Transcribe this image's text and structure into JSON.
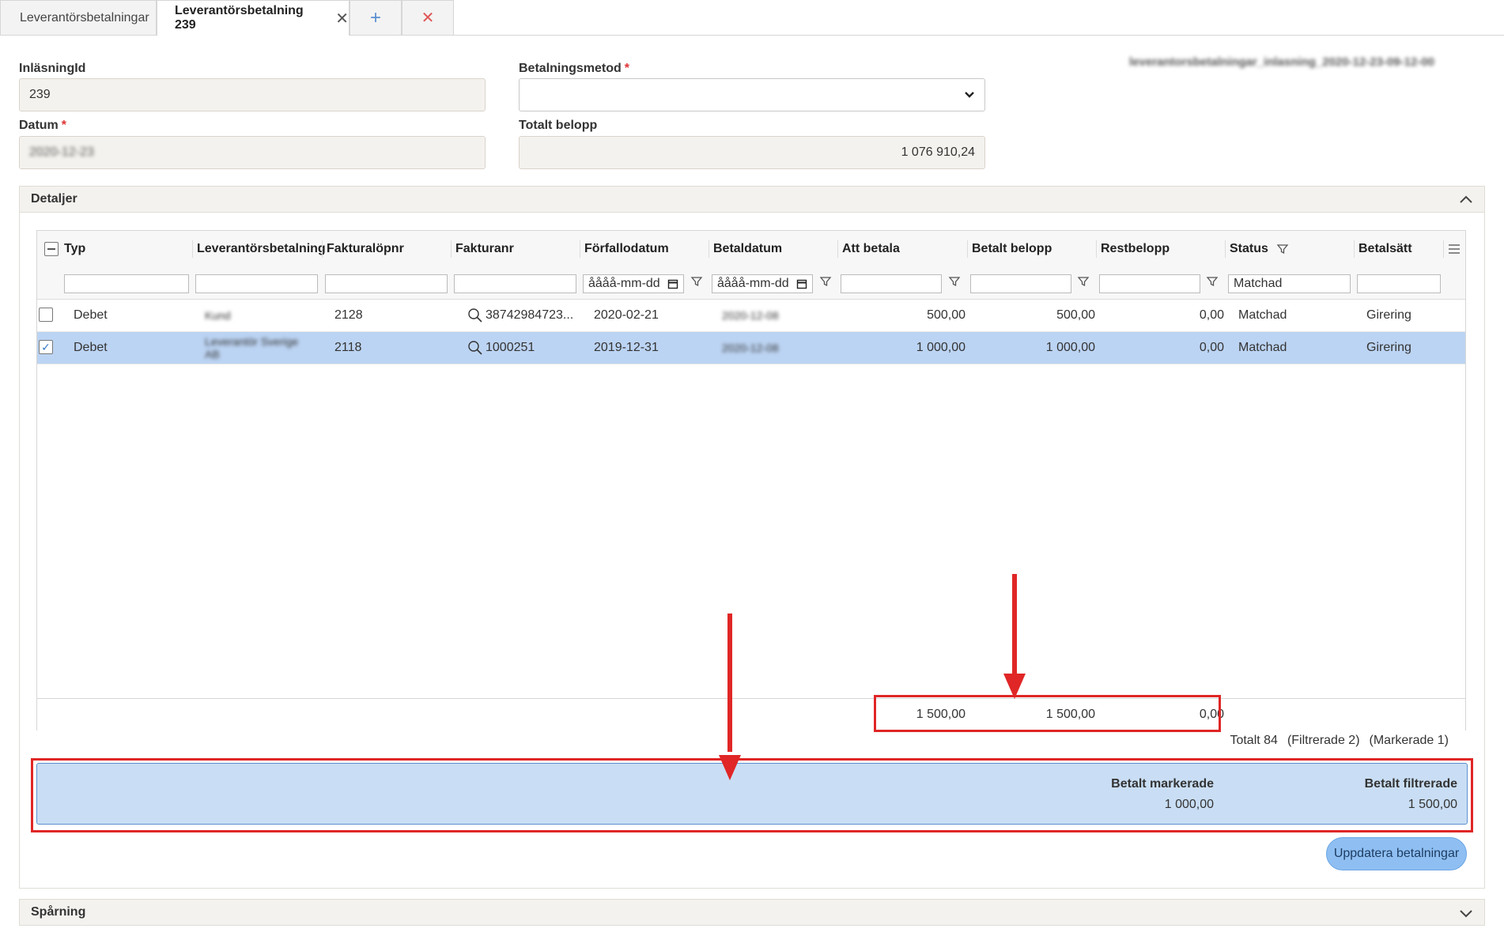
{
  "tabs": {
    "list_tab": "Leverantörsbetalningar",
    "active_tab": "Leverantörsbetalning 239",
    "close_icon": "✕",
    "add_icon": "+",
    "close_all_icon": "✕"
  },
  "form": {
    "id_label": "InläsningId",
    "id_value": "239",
    "date_label": "Datum",
    "date_required": "*",
    "date_value": "2020-12-23",
    "method_label": "Betalningsmetod",
    "method_required": "*",
    "method_value": "",
    "total_label": "Totalt belopp",
    "total_value": "1 076 910,24",
    "file_name": "leverantorsbetalningar_inlasning_2020-12-23-09-12-00"
  },
  "details": {
    "title": "Detaljer",
    "columns": [
      "Typ",
      "Leverantörsbetalning",
      "Fakturalöpnr",
      "Fakturanr",
      "Förfallodatum",
      "Betaldatum",
      "Att betala",
      "Betalt belopp",
      "Restbelopp",
      "Status",
      "Betalsätt"
    ],
    "filters": {
      "date_placeholder": "åååå-mm-dd",
      "status_value": "Matchad"
    },
    "rows": [
      {
        "typ": "Debet",
        "leverantor": "Kund",
        "lopnr": "2128",
        "fakturanr": "38742984723...",
        "forfallo": "2020-02-21",
        "betaldatum": "2020-12-08",
        "att_betala": "500,00",
        "betalt": "500,00",
        "rest": "0,00",
        "status": "Matchad",
        "betalsatt": "Girering",
        "selected": false
      },
      {
        "typ": "Debet",
        "leverantor": "Leverantör Sverige AB",
        "lopnr": "2118",
        "fakturanr": "1000251",
        "forfallo": "2019-12-31",
        "betaldatum": "2020-12-08",
        "att_betala": "1 000,00",
        "betalt": "1 000,00",
        "rest": "0,00",
        "status": "Matchad",
        "betalsatt": "Girering",
        "selected": true
      }
    ],
    "sums": {
      "att_betala": "1 500,00",
      "betalt": "1 500,00",
      "rest": "0,00"
    },
    "totals": {
      "total": "Totalt 84",
      "filtered": "(Filtrerade 2)",
      "marked": "(Markerade 1)"
    },
    "paid_marked_label": "Betalt markerade",
    "paid_marked_value": "1 000,00",
    "paid_filtered_label": "Betalt filtrerade",
    "paid_filtered_value": "1 500,00",
    "update_button": "Uppdatera betalningar"
  },
  "tracking": {
    "title": "Spårning"
  },
  "colors": {
    "annotation": "#e02626",
    "selected_row": "#bcd4f3",
    "summary_bar": "#c9def4",
    "button": "#8fbff2"
  },
  "icons": {
    "collapse": "chevron-up-icon",
    "expand": "chevron-down-icon",
    "filter": "filter-icon",
    "search": "search-icon",
    "calendar": "calendar-icon",
    "menu": "column-menu-icon"
  }
}
